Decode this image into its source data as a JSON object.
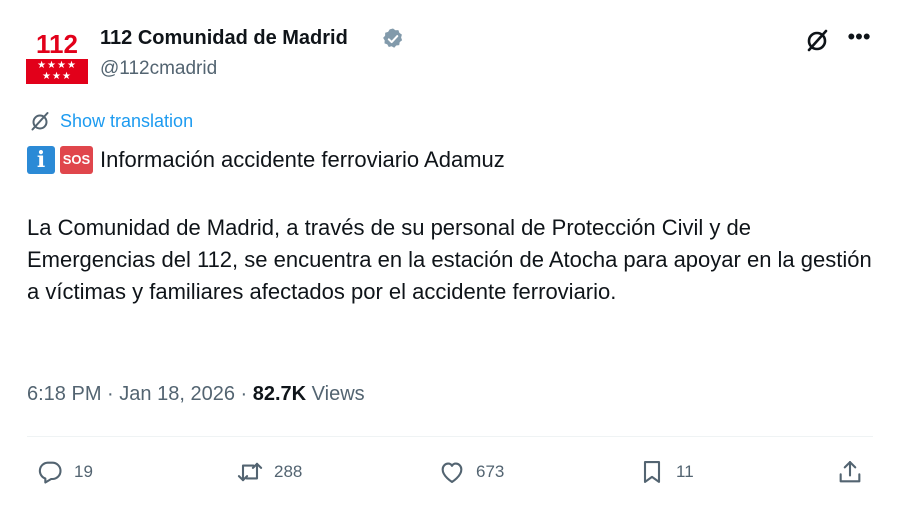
{
  "account": {
    "avatar_number": "112",
    "avatar_stars_row1": "★★★★",
    "avatar_stars_row2": "★★★",
    "display_name": "112 Comunidad de Madrid",
    "handle": "@112cmadrid",
    "verified": true
  },
  "translation": {
    "label": "Show translation"
  },
  "post": {
    "emoji_info": "i",
    "emoji_sos": "SOS",
    "headline": "Información accidente ferroviario Adamuz",
    "body": "La Comunidad de Madrid, a través de su personal de Protección Civil y de Emergencias del 112, se encuentra en la estación de Atocha para apoyar en la gestión a víctimas y familiares afectados por el accidente ferroviario."
  },
  "meta": {
    "time": "6:18 PM",
    "separator": "·",
    "date": "Jan 18, 2026",
    "views_count": "82.7K",
    "views_label": "Views"
  },
  "actions": {
    "replies": "19",
    "reposts": "288",
    "likes": "673",
    "bookmarks": "11"
  },
  "colors": {
    "accent": "#1d9bf0",
    "secondary_text": "#536471",
    "primary_text": "#0f1419",
    "brand_red": "#e2001a"
  },
  "icons": [
    "grok-icon",
    "more-icon",
    "verified-badge-icon",
    "translate-icon",
    "reply-icon",
    "repost-icon",
    "like-icon",
    "bookmark-icon",
    "share-icon"
  ]
}
